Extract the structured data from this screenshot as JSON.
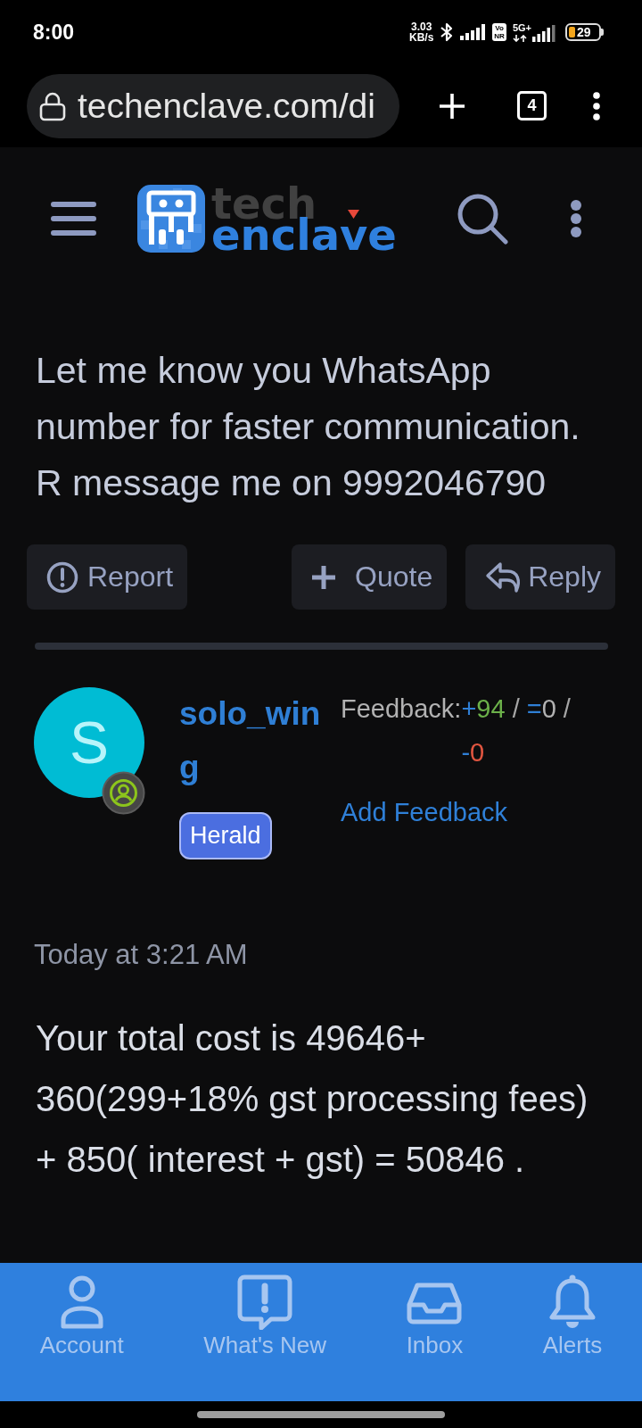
{
  "status_bar": {
    "time": "8:00",
    "net_speed": "3.03",
    "net_speed_unit": "KB/s",
    "vonr_top": "Vo",
    "vonr_bottom": "NR",
    "network_type": "5G+",
    "battery": "29"
  },
  "browser": {
    "url": "techenclave.com/di",
    "tab_count": "4"
  },
  "site_header": {
    "logo_top": "tech",
    "logo_bottom": "enclave"
  },
  "post": {
    "message": "Let me know you WhatsApp number for faster communication. R message me on 9992046790",
    "actions": [
      {
        "kind": "report",
        "label": "Report"
      },
      {
        "kind": "quote",
        "label": "Quote"
      },
      {
        "kind": "reply",
        "label": "Reply"
      }
    ]
  },
  "reply": {
    "avatar_letter": "S",
    "username": "solo_wing",
    "user_title": "Herald",
    "feedback": {
      "label": "Feedback:",
      "counts": [
        {
          "kind": "positive",
          "sign": "+",
          "value": "94",
          "separator": "/"
        },
        {
          "kind": "neutral",
          "sign": "=",
          "value": "0",
          "separator": "/"
        },
        {
          "kind": "negative",
          "sign": "-",
          "value": "0"
        }
      ]
    },
    "add_feedback": "Add Feedback",
    "time": "Today at 3:21 AM",
    "message": "Your total cost is 49646+\n360(299+18% gst processing fees)\n+ 850( interest + gst) = 50846 ."
  },
  "bottom_nav": [
    {
      "kind": "account",
      "label": "Account"
    },
    {
      "kind": "whats_new",
      "label": "What's New"
    },
    {
      "kind": "inbox",
      "label": "Inbox"
    },
    {
      "kind": "alerts",
      "label": "Alerts"
    }
  ]
}
